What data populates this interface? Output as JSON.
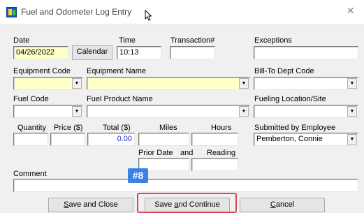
{
  "window": {
    "title": "Fuel and Odometer Log Entry",
    "close_glyph": "✕"
  },
  "labels": {
    "date": "Date",
    "time": "Time",
    "transaction": "Transaction#",
    "exceptions": "Exceptions",
    "equipment_code": "Equipment Code",
    "equipment_name": "Equipment Name",
    "bill_to_dept": "Bill-To Dept Code",
    "fuel_code": "Fuel Code",
    "fuel_product_name": "Fuel Product Name",
    "fueling_location": "Fueling Location/Site",
    "quantity": "Quantity",
    "price": "Price ($)",
    "total": "Total ($)",
    "miles": "Miles",
    "hours": "Hours",
    "submitted_by": "Submitted by Employee",
    "prior_date": "Prior Date",
    "and": "and",
    "reading": "Reading",
    "comment": "Comment"
  },
  "fields": {
    "date": "04/26/2022",
    "time": "10:13",
    "transaction": "",
    "exceptions": "",
    "equipment_code": "",
    "equipment_name": "",
    "bill_to_dept": "",
    "fuel_code": "",
    "fuel_product_name": "",
    "fueling_location": "",
    "quantity": "",
    "price": "",
    "total": "0.00",
    "miles": "",
    "hours": "",
    "submitted_by": "Pemberton, Connie",
    "prior_date": "",
    "reading": "",
    "comment": ""
  },
  "buttons": {
    "calendar": "Calendar",
    "save_close_accel": "S",
    "save_close_rest": "ave and Close",
    "save_continue_pre": "Save ",
    "save_continue_accel": "a",
    "save_continue_rest": "nd Continue",
    "cancel_accel": "C",
    "cancel_rest": "ancel"
  },
  "annotation": {
    "badge": "#8",
    "highlight_color": "#d9465e",
    "badge_color": "#3b82e6"
  },
  "colors": {
    "required_field": "#ffffc8",
    "total_value": "#1a2fcc"
  }
}
